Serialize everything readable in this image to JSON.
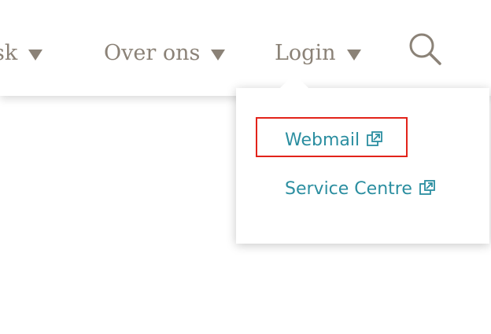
{
  "nav": {
    "items": [
      {
        "label": "sk"
      },
      {
        "label": "Over ons"
      },
      {
        "label": "Login"
      }
    ]
  },
  "search": {
    "icon": "search-icon"
  },
  "login_menu": {
    "items": [
      {
        "label": "Webmail",
        "icon": "external-link-icon",
        "highlighted": true
      },
      {
        "label": "Service Centre",
        "icon": "external-link-icon",
        "highlighted": false
      }
    ]
  },
  "colors": {
    "nav_text": "#8b8277",
    "link": "#2b8ea0",
    "highlight_border": "#e2231a"
  }
}
